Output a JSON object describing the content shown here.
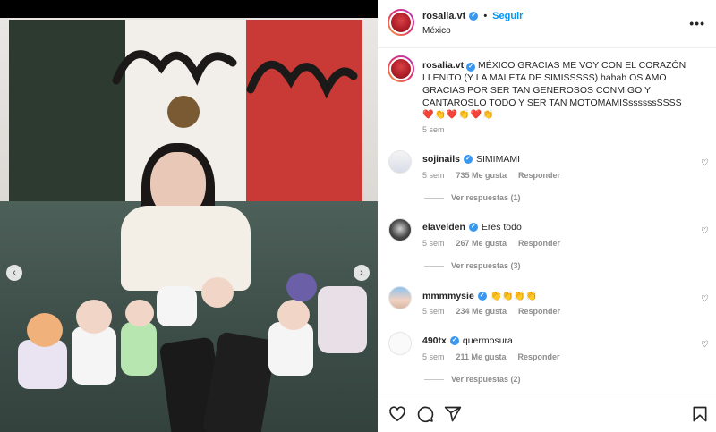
{
  "post": {
    "username": "rosalia.vt",
    "follow_label": "Seguir",
    "location": "México",
    "more_label": "•••",
    "caption": {
      "username": "rosalia.vt",
      "text": "MÉXICO GRACIAS ME VOY CON EL CORAZÓN LLENITO (Y LA MALETA DE SIMISSSSS) hahah OS AMO GRACIAS POR SER TAN GENEROSOS CONMIGO Y CANTAROSLO TODO Y SER TAN MOTOMAMISssssssSSSS",
      "emojis": "❤️👏❤️👏❤️👏",
      "time": "5 sem"
    }
  },
  "comments": [
    {
      "username": "sojinails",
      "text": "SIMIMAMI",
      "time": "5 sem",
      "likes": "735 Me gusta",
      "reply_label": "Responder",
      "replies": "Ver respuestas (1)"
    },
    {
      "username": "elavelden",
      "text": "Eres todo",
      "time": "5 sem",
      "likes": "267 Me gusta",
      "reply_label": "Responder",
      "replies": "Ver respuestas (3)"
    },
    {
      "username": "mmmmysie",
      "text": "👏👏👏👏",
      "time": "5 sem",
      "likes": "234 Me gusta",
      "reply_label": "Responder"
    },
    {
      "username": "490tx",
      "text": "quermosura",
      "time": "5 sem",
      "likes": "211 Me gusta",
      "reply_label": "Responder",
      "replies": "Ver respuestas (2)"
    }
  ],
  "icons": {
    "like": "heart-icon",
    "comment": "comment-icon",
    "share": "share-icon",
    "save": "bookmark-icon",
    "prev": "chevron-left-icon",
    "next": "chevron-right-icon"
  },
  "colors": {
    "accent": "#0095f6",
    "verified": "#3897f0",
    "muted": "#8e8e8e",
    "text": "#262626"
  }
}
